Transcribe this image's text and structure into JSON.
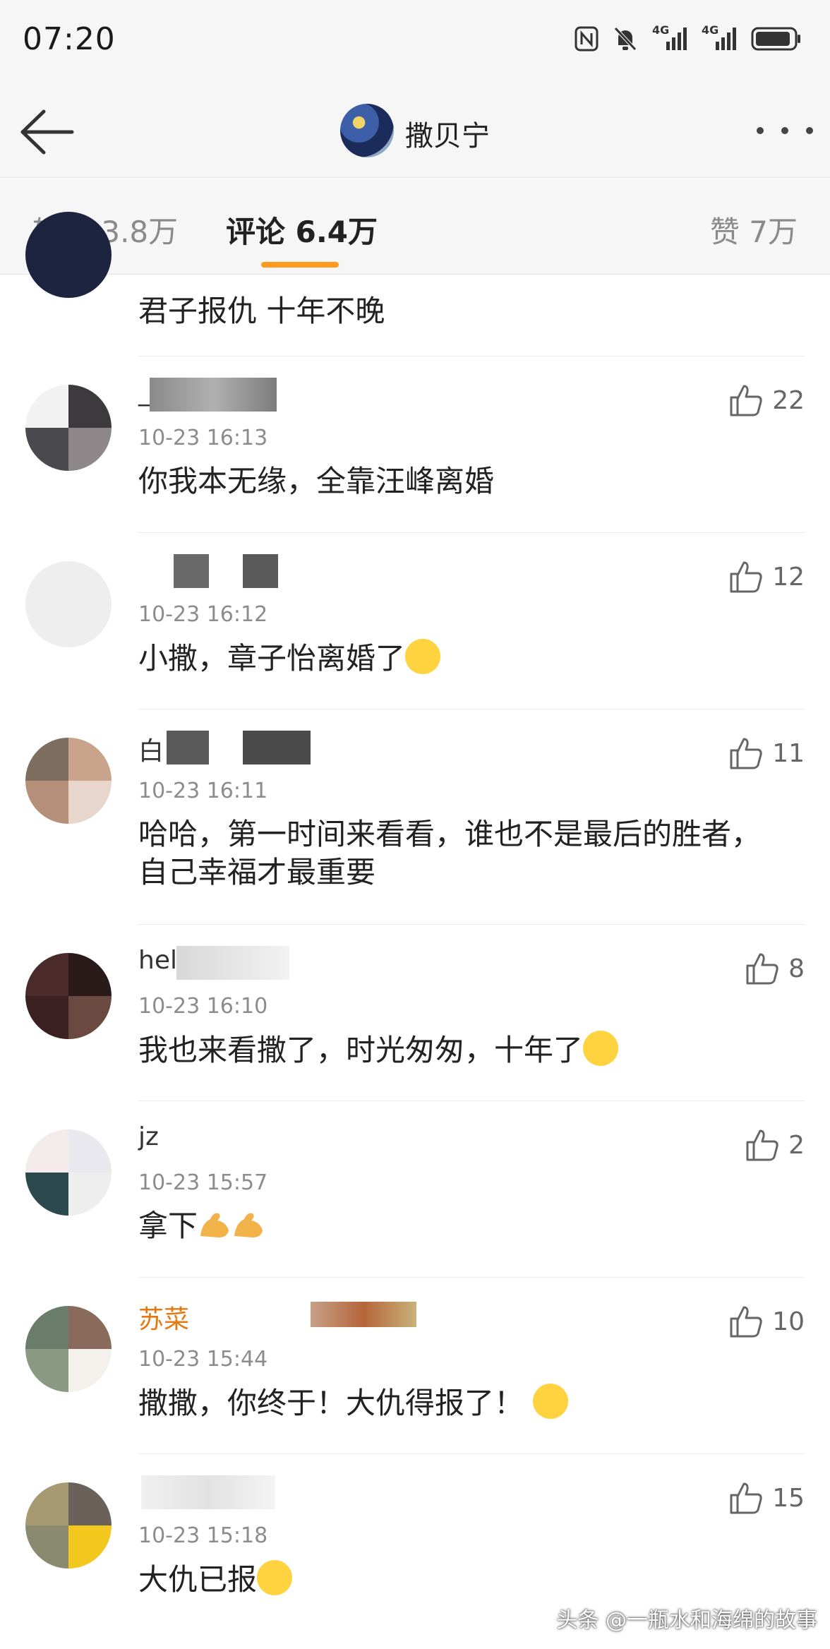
{
  "status_bar": {
    "time": "07:20",
    "network1": "4G",
    "network2": "4G"
  },
  "header": {
    "title": "撒贝宁"
  },
  "tabs": [
    {
      "label": "转发 3.8万"
    },
    {
      "label": "评论 6.4万"
    },
    {
      "label": "赞 7万"
    }
  ],
  "comments": [
    {
      "name": "",
      "date": "",
      "text": "君子报仇 十年不晚",
      "likes": ""
    },
    {
      "name": "_",
      "date": "10-23 16:13",
      "text": "你我本无缘，全靠汪峰离婚",
      "likes": "22"
    },
    {
      "name": "​",
      "date": "10-23 16:12",
      "text": "小撒，章子怡离婚了",
      "likes": "12"
    },
    {
      "name": "白",
      "date": "10-23 16:11",
      "text": "哈哈，第一时间来看看，谁也不是最后的胜者，自己幸福才最重要",
      "likes": "11"
    },
    {
      "name": "hel",
      "date": "10-23 16:10",
      "text": "我也来看撒了，时光匆匆，十年了",
      "likes": "8"
    },
    {
      "name": "jz",
      "date": "10-23 15:57",
      "text": "拿下",
      "likes": "2"
    },
    {
      "name": "苏菜",
      "date": "10-23 15:44",
      "text": "撒撒，你终于！大仇得报了！",
      "likes": "10"
    },
    {
      "name": "",
      "date": "10-23 15:18",
      "text": "大仇已报",
      "likes": "15"
    }
  ],
  "watermark": "头条 @一瓶水和海绵的故事",
  "colors": {
    "accent": "#ff9a1f",
    "orange_name": "#e5780f"
  },
  "icons": [
    "back-arrow-icon",
    "more-icon",
    "thumbs-up-icon",
    "nfc-icon",
    "mute-bell-icon",
    "signal-icon",
    "battery-icon"
  ]
}
